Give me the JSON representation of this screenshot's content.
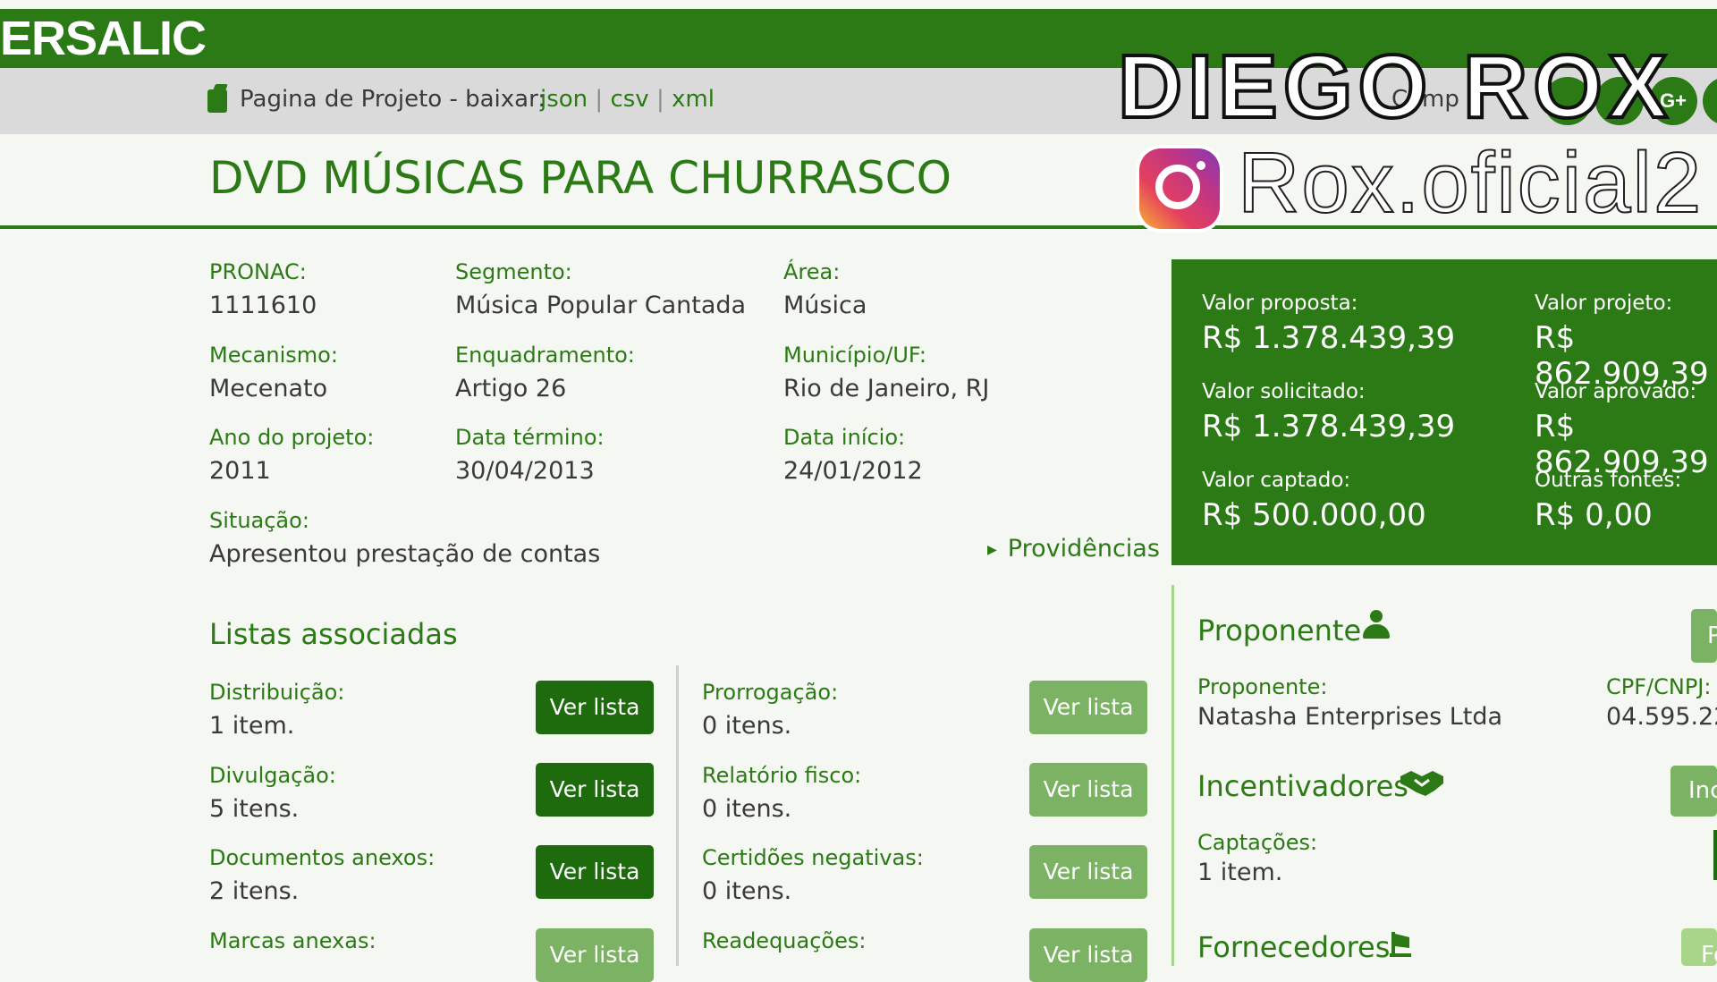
{
  "header": {
    "logo_text": "ERSALIC"
  },
  "subbar": {
    "label": "Pagina de Projeto - baixar:",
    "link_json": "json",
    "sep1": "|",
    "link_csv": "csv",
    "sep2": "|",
    "link_xml": "xml",
    "compartilhar": "Comp",
    "social": [
      "G+"
    ]
  },
  "watermark": {
    "name": "DIEGO ROX",
    "handle": "Rox.oficial2",
    "icon": "instagram-icon"
  },
  "project": {
    "title": "DVD MÚSICAS PARA CHURRASCO",
    "fields": {
      "pronac": {
        "label": "PRONAC:",
        "value": "1111610"
      },
      "segmento": {
        "label": "Segmento:",
        "value": "Música Popular Cantada"
      },
      "area": {
        "label": "Área:",
        "value": "Música"
      },
      "mecanismo": {
        "label": "Mecanismo:",
        "value": "Mecenato"
      },
      "enquadramento": {
        "label": "Enquadramento:",
        "value": "Artigo 26"
      },
      "municipio": {
        "label": "Município/UF:",
        "value": "Rio de Janeiro, RJ"
      },
      "ano": {
        "label": "Ano do projeto:",
        "value": "2011"
      },
      "termino": {
        "label": "Data término:",
        "value": "30/04/2013"
      },
      "inicio": {
        "label": "Data início:",
        "value": "24/01/2012"
      },
      "situacao": {
        "label": "Situação:",
        "value": "Apresentou prestação de contas"
      }
    },
    "providencias": "Providências"
  },
  "values": {
    "proposta": {
      "label": "Valor proposta:",
      "value": "R$ 1.378.439,39"
    },
    "projeto": {
      "label": "Valor projeto:",
      "value": "R$ 862.909,39"
    },
    "solicitado": {
      "label": "Valor solicitado:",
      "value": "R$ 1.378.439,39"
    },
    "aprovado": {
      "label": "Valor aprovado:",
      "value": "R$ 862.909,39"
    },
    "captado": {
      "label": "Valor captado:",
      "value": "R$ 500.000,00"
    },
    "outras": {
      "label": "Outras fontes:",
      "value": "R$ 0,00"
    }
  },
  "lists": {
    "title": "Listas associadas",
    "button_label": "Ver lista",
    "left": [
      {
        "label": "Distribuição:",
        "count": "1 item."
      },
      {
        "label": "Divulgação:",
        "count": "5 itens."
      },
      {
        "label": "Documentos anexos:",
        "count": "2 itens."
      },
      {
        "label": "Marcas anexas:",
        "count": ""
      }
    ],
    "right": [
      {
        "label": "Prorrogação:",
        "count": "0 itens."
      },
      {
        "label": "Relatório fisco:",
        "count": "0 itens."
      },
      {
        "label": "Certidões negativas:",
        "count": "0 itens."
      },
      {
        "label": "Readequações:",
        "count": ""
      }
    ]
  },
  "proponente": {
    "title": "Proponente",
    "name_label": "Proponente:",
    "name_value": "Natasha Enterprises Ltda",
    "cpf_label": "CPF/CNPJ:",
    "cpf_value": "04.595.22",
    "edge_button": "P"
  },
  "incentivadores": {
    "title": "Incentivadores",
    "captacoes_label": "Captações:",
    "captacoes_value": "1 item.",
    "edge_button": "Inc"
  },
  "fornecedores": {
    "title": "Fornecedores",
    "edge_button": "Fo"
  },
  "colors": {
    "brand_green": "#2b7a15",
    "button_dark": "#1e6b0e",
    "button_light": "#7bb263"
  }
}
